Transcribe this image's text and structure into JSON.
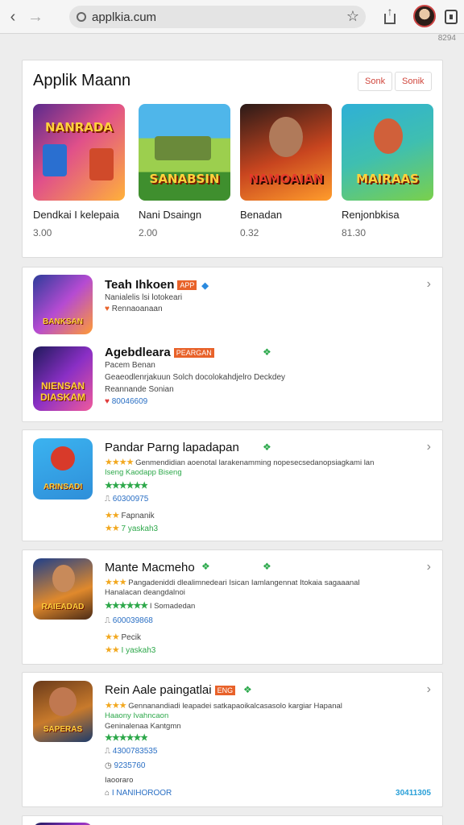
{
  "browser": {
    "url": "applkia.cum",
    "status_number": "8294"
  },
  "section": {
    "title": "Applik Maann",
    "chips": [
      "Sonk",
      "Sonik"
    ]
  },
  "featured": [
    {
      "name": "Dendkai I kelepaia",
      "price": "3.00",
      "art_label": "NANRADA"
    },
    {
      "name": "Nani Dsaingn",
      "price": "2.00",
      "art_label": "SANABSIN"
    },
    {
      "name": "Benadan",
      "price": "0.32",
      "art_label": "NAMOAIAN"
    },
    {
      "name": "Renjonbkisa",
      "price": "81.30",
      "art_label": "MAIRAAS"
    }
  ],
  "list": [
    {
      "title": "Teah Ihkoen",
      "badge": "APP",
      "icon_label": "BANKSAN",
      "lines": [
        "Nanialelis lsi lotokeari",
        "Rennaoanaan"
      ]
    },
    {
      "title": "Agebdleara",
      "badge": "PEARGAN",
      "icon_label": "NIENSAN DIASKAM",
      "lines": [
        "Pacem Benan",
        "Geaeodlenrjakuun Solch docolokahdjelro Deckdey",
        "Reannande Sonian",
        "80046609"
      ]
    },
    {
      "title": "Pandar Parng lapadapan",
      "icon_label": "ARINSADI",
      "lines": [
        "Genmendidian aoenotal larakenamming nopesecsedanopsiagkami lan",
        "Iseng Kaodapp Biseng",
        "60300975",
        "Fapnanik",
        "7 yaskah3"
      ]
    },
    {
      "title": "Mante Macmeho",
      "icon_label": "RAIEADAD",
      "lines": [
        "Pangadeniddi dlealimnedeari Isican Iamlangennat Itokaia sagaaanal",
        "Hanalacan deangdalnoi",
        "I Somadedan",
        "600039868",
        "Pecik",
        "I yaskah3"
      ]
    },
    {
      "title": "Rein Aale paingatlai",
      "badge": "ENG",
      "icon_label": "SAPERAS",
      "lines": [
        "Gennanandiadi leapadei satkapaoikalcasasolo kargiar Hapanal",
        "Haaony Ivahncaon",
        "Geninalenaa Kantgmn",
        "4300783535",
        "9235760",
        "Iaooraro",
        "I NANIHOROOR"
      ],
      "right_value": "30411305"
    }
  ],
  "colors": {
    "accent": "#e8622a",
    "star": "#f2a81f",
    "green": "#2da84a",
    "link": "#2a6fc4"
  }
}
